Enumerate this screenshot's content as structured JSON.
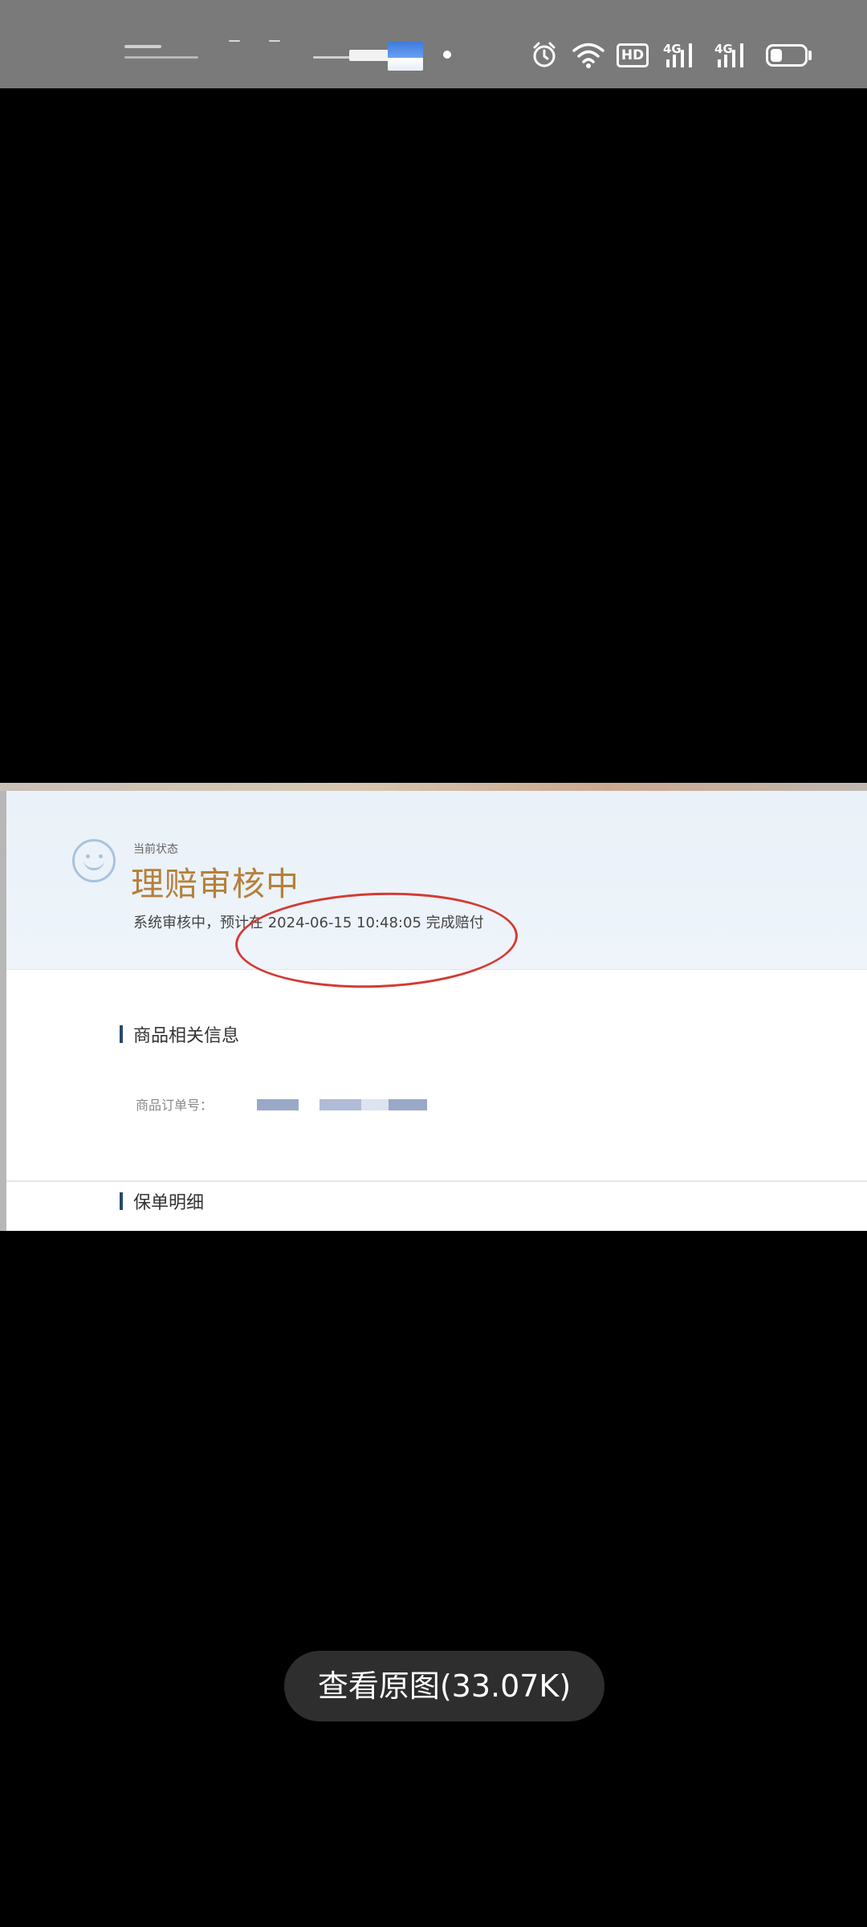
{
  "status_bar": {
    "hd_label": "HD",
    "network_1": "4G",
    "network_2": "4G",
    "battery_level": 0.35,
    "icons": [
      "alarm-icon",
      "wifi-icon",
      "hd-icon",
      "signal-icon",
      "signal-icon",
      "battery-icon"
    ]
  },
  "photo": {
    "current_status_caption": "当前状态",
    "status_title": "理赔审核中",
    "status_description": "系统审核中，预计在 2024-06-15 10:48:05 完成赔付",
    "annotation_color": "#d33b33",
    "section_product": "商品相关信息",
    "order_number_label": "商品订单号：",
    "section_policy": "保单明细"
  },
  "viewer": {
    "view_original_label": "查看原图(33.07K)"
  }
}
